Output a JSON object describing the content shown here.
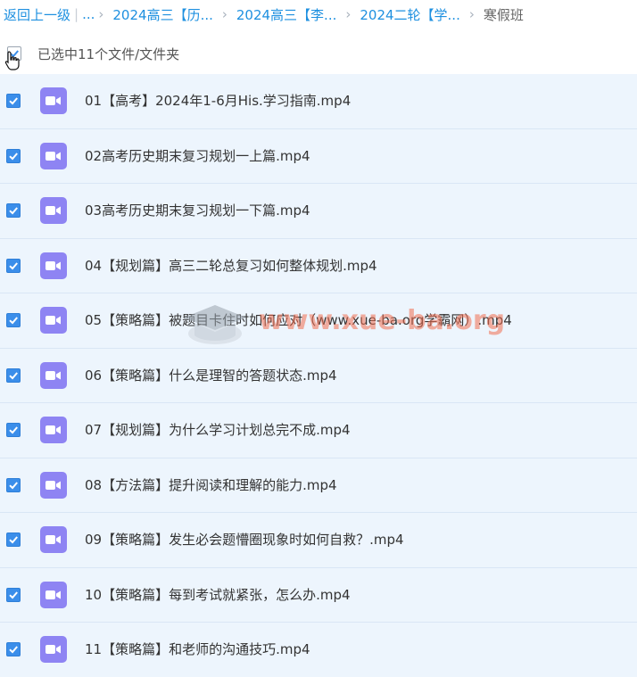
{
  "breadcrumb": {
    "back_label": "返回上一级",
    "ellipsis": "...",
    "items": [
      "2024高三【历...",
      "2024高三【李...",
      "2024二轮【学...",
      "寒假班"
    ]
  },
  "selection": {
    "label": "已选中11个文件/文件夹"
  },
  "files": [
    {
      "name": "01【高考】2024年1-6月His.学习指南.mp4",
      "checked": true
    },
    {
      "name": "02高考历史期末复习规划一上篇.mp4",
      "checked": true
    },
    {
      "name": "03高考历史期末复习规划一下篇.mp4",
      "checked": true
    },
    {
      "name": "04【规划篇】高三二轮总复习如何整体规划.mp4",
      "checked": true
    },
    {
      "name": "05【策略篇】被题目卡住时如何应对（www.xue-ba.org学霸网）.mp4",
      "checked": true
    },
    {
      "name": "06【策略篇】什么是理智的答题状态.mp4",
      "checked": true
    },
    {
      "name": "07【规划篇】为什么学习计划总完不成.mp4",
      "checked": true
    },
    {
      "name": "08【方法篇】提升阅读和理解的能力.mp4",
      "checked": true
    },
    {
      "name": "09【策略篇】发生必会题懵圈现象时如何自救？.mp4",
      "checked": true
    },
    {
      "name": "10【策略篇】每到考试就紧张，怎么办.mp4",
      "checked": true
    },
    {
      "name": "11【策略篇】和老师的沟通技巧.mp4",
      "checked": true
    }
  ],
  "watermark": {
    "text": "www.xue-ba.org"
  },
  "colors": {
    "link": "#1e90e0",
    "row_bg": "#edf5fd",
    "checkbox": "#3b8eea",
    "video_icon": "#8e84f3"
  }
}
